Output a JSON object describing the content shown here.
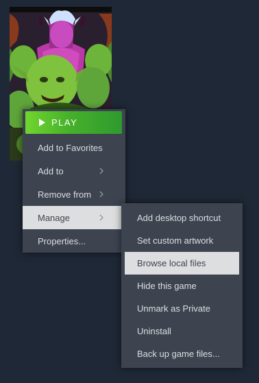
{
  "game": {
    "capsule_art_icon": "goblin-game-cover-art"
  },
  "context_menu": {
    "play_label": "PLAY",
    "items": [
      {
        "label": "Add to Favorites",
        "has_submenu": false
      },
      {
        "label": "Add to",
        "has_submenu": true
      },
      {
        "label": "Remove from",
        "has_submenu": true
      },
      {
        "label": "Manage",
        "has_submenu": true,
        "active": true
      },
      {
        "label": "Properties...",
        "has_submenu": false
      }
    ]
  },
  "manage_submenu": {
    "items": [
      {
        "label": "Add desktop shortcut"
      },
      {
        "label": "Set custom artwork"
      },
      {
        "label": "Browse local files",
        "hovered": true
      },
      {
        "label": "Hide this game"
      },
      {
        "label": "Unmark as Private"
      },
      {
        "label": "Uninstall"
      },
      {
        "label": "Back up game files..."
      }
    ]
  },
  "colors": {
    "background": "#1f2836",
    "menu_bg": "#3d4450",
    "menu_text": "#dcdedf",
    "highlight_bg": "#dcdedf",
    "play_green": "#5cb82d"
  }
}
